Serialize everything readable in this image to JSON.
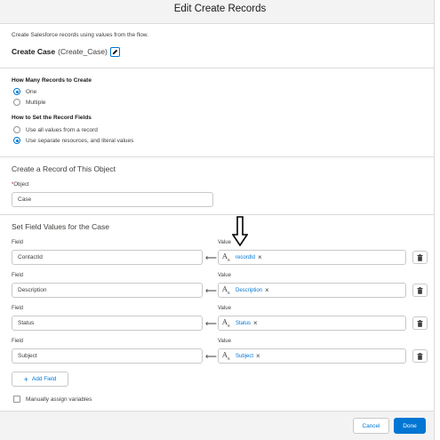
{
  "modal": {
    "title": "Edit Create Records",
    "description": "Create Salesforce records using values from the flow.",
    "api_label": "Create Case",
    "api_name": "(Create_Case)"
  },
  "how_many": {
    "label": "How Many Records to Create",
    "options": [
      "One",
      "Multiple"
    ],
    "selected": "One"
  },
  "how_to_set": {
    "label": "How to Set the Record Fields",
    "options": [
      "Use all values from a record",
      "Use separate resources, and literal values"
    ],
    "selected": "Use separate resources, and literal values"
  },
  "object_section": {
    "title": "Create a Record of This Object",
    "required_marker": "*",
    "field_label": "Object",
    "value": "Case"
  },
  "field_values": {
    "title": "Set Field Values for the Case",
    "field_col_label": "Field",
    "value_col_label": "Value",
    "rows": [
      {
        "field": "ContactId",
        "value": "recordId"
      },
      {
        "field": "Description",
        "value": "Description"
      },
      {
        "field": "Status",
        "value": "Status"
      },
      {
        "field": "Subject",
        "value": "Subject"
      }
    ],
    "value_icon": "text-resource-icon"
  },
  "add_field_label": "Add Field",
  "manual_assign_label": "Manually assign variables",
  "footer": {
    "cancel_label": "Cancel",
    "done_label": "Done"
  },
  "colors": {
    "brand": "#0176d3",
    "header_bg": "#f3f3f3",
    "border": "#c9c9c9"
  }
}
